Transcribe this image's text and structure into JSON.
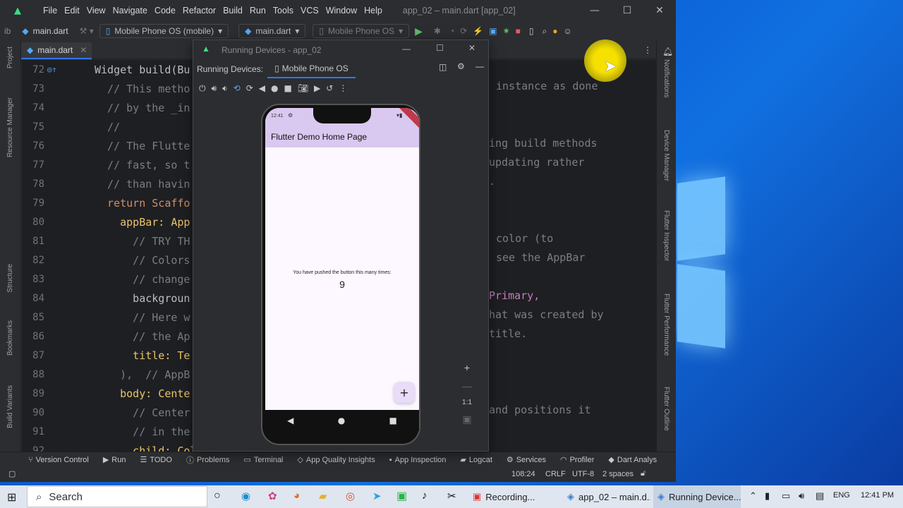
{
  "ide": {
    "menu": [
      "File",
      "Edit",
      "View",
      "Navigate",
      "Code",
      "Refactor",
      "Build",
      "Run",
      "Tools",
      "VCS",
      "Window",
      "Help"
    ],
    "window_title": "app_02 – main.dart [app_02]",
    "toolbar": {
      "breadcrumb_prefix": "ib",
      "file": "main.dart",
      "device": "Mobile Phone OS (mobile)",
      "run_config": "main.dart",
      "device2": "Mobile Phone OS"
    },
    "tab": "main.dart",
    "left_tools": [
      "Project",
      "Resource Manager",
      "Structure",
      "Bookmarks",
      "Build Variants"
    ],
    "right_tools": [
      "Notifications",
      "Device Manager",
      "Flutter Inspector",
      "Flutter Performance",
      "Flutter Outline"
    ],
    "code": [
      {
        "n": "72",
        "t": "Widget build(Bu"
      },
      {
        "n": "73",
        "t": "  // This metho"
      },
      {
        "n": "74",
        "t": "  // by the _in"
      },
      {
        "n": "75",
        "t": "  //"
      },
      {
        "n": "76",
        "t": "  // The Flutte"
      },
      {
        "n": "77",
        "t": "  // fast, so t"
      },
      {
        "n": "78",
        "t": "  // than havin"
      },
      {
        "n": "79",
        "t": "  return Scaffo"
      },
      {
        "n": "80",
        "t": "    appBar: App"
      },
      {
        "n": "81",
        "t": "      // TRY TH"
      },
      {
        "n": "82",
        "t": "      // Colors"
      },
      {
        "n": "83",
        "t": "      // change"
      },
      {
        "n": "84",
        "t": "      backgroun"
      },
      {
        "n": "85",
        "t": "      // Here w"
      },
      {
        "n": "86",
        "t": "      // the Ap"
      },
      {
        "n": "87",
        "t": "      title: Te"
      },
      {
        "n": "88",
        "t": "    ),  // AppB"
      },
      {
        "n": "89",
        "t": "    body: Cente"
      },
      {
        "n": "90",
        "t": "      // Center"
      },
      {
        "n": "91",
        "t": "      // in the"
      },
      {
        "n": "92",
        "t": "      child: Column("
      }
    ],
    "code_right": [
      {
        "n": "73",
        "t": "instance as done"
      },
      {
        "n": "76",
        "t": "ing build methods"
      },
      {
        "n": "77",
        "t": "updating rather"
      },
      {
        "n": "78",
        "t": "."
      },
      {
        "n": "81",
        "t": "color (to"
      },
      {
        "n": "82",
        "t": "see the AppBar"
      },
      {
        "n": "84",
        "t": "Primary,"
      },
      {
        "n": "85",
        "t": "hat was created by"
      },
      {
        "n": "86",
        "t": "title."
      },
      {
        "n": "90",
        "t": "and positions it"
      }
    ],
    "bottom_tools": [
      "Version Control",
      "Run",
      "TODO",
      "Problems",
      "Terminal",
      "App Quality Insights",
      "App Inspection",
      "Logcat",
      "Services",
      "Profiler",
      "Dart Analys"
    ],
    "status": {
      "position": "108:24",
      "line_sep": "CRLF",
      "encoding": "UTF-8",
      "indent": "2 spaces"
    }
  },
  "running_devices": {
    "title": "Running Devices - app_02",
    "label": "Running Devices:",
    "tab": "Mobile Phone OS",
    "zoom_label": "1:1"
  },
  "phone": {
    "time": "12:41",
    "app_title": "Flutter Demo Home Page",
    "message": "You have pushed the button this many times:",
    "counter": "9",
    "fab": "+"
  },
  "taskbar": {
    "search": "Search",
    "tasks": [
      "Recording...",
      "app_02 – main.d...",
      "Running Device..."
    ],
    "lang": "ENG",
    "time": "12:41 PM"
  }
}
